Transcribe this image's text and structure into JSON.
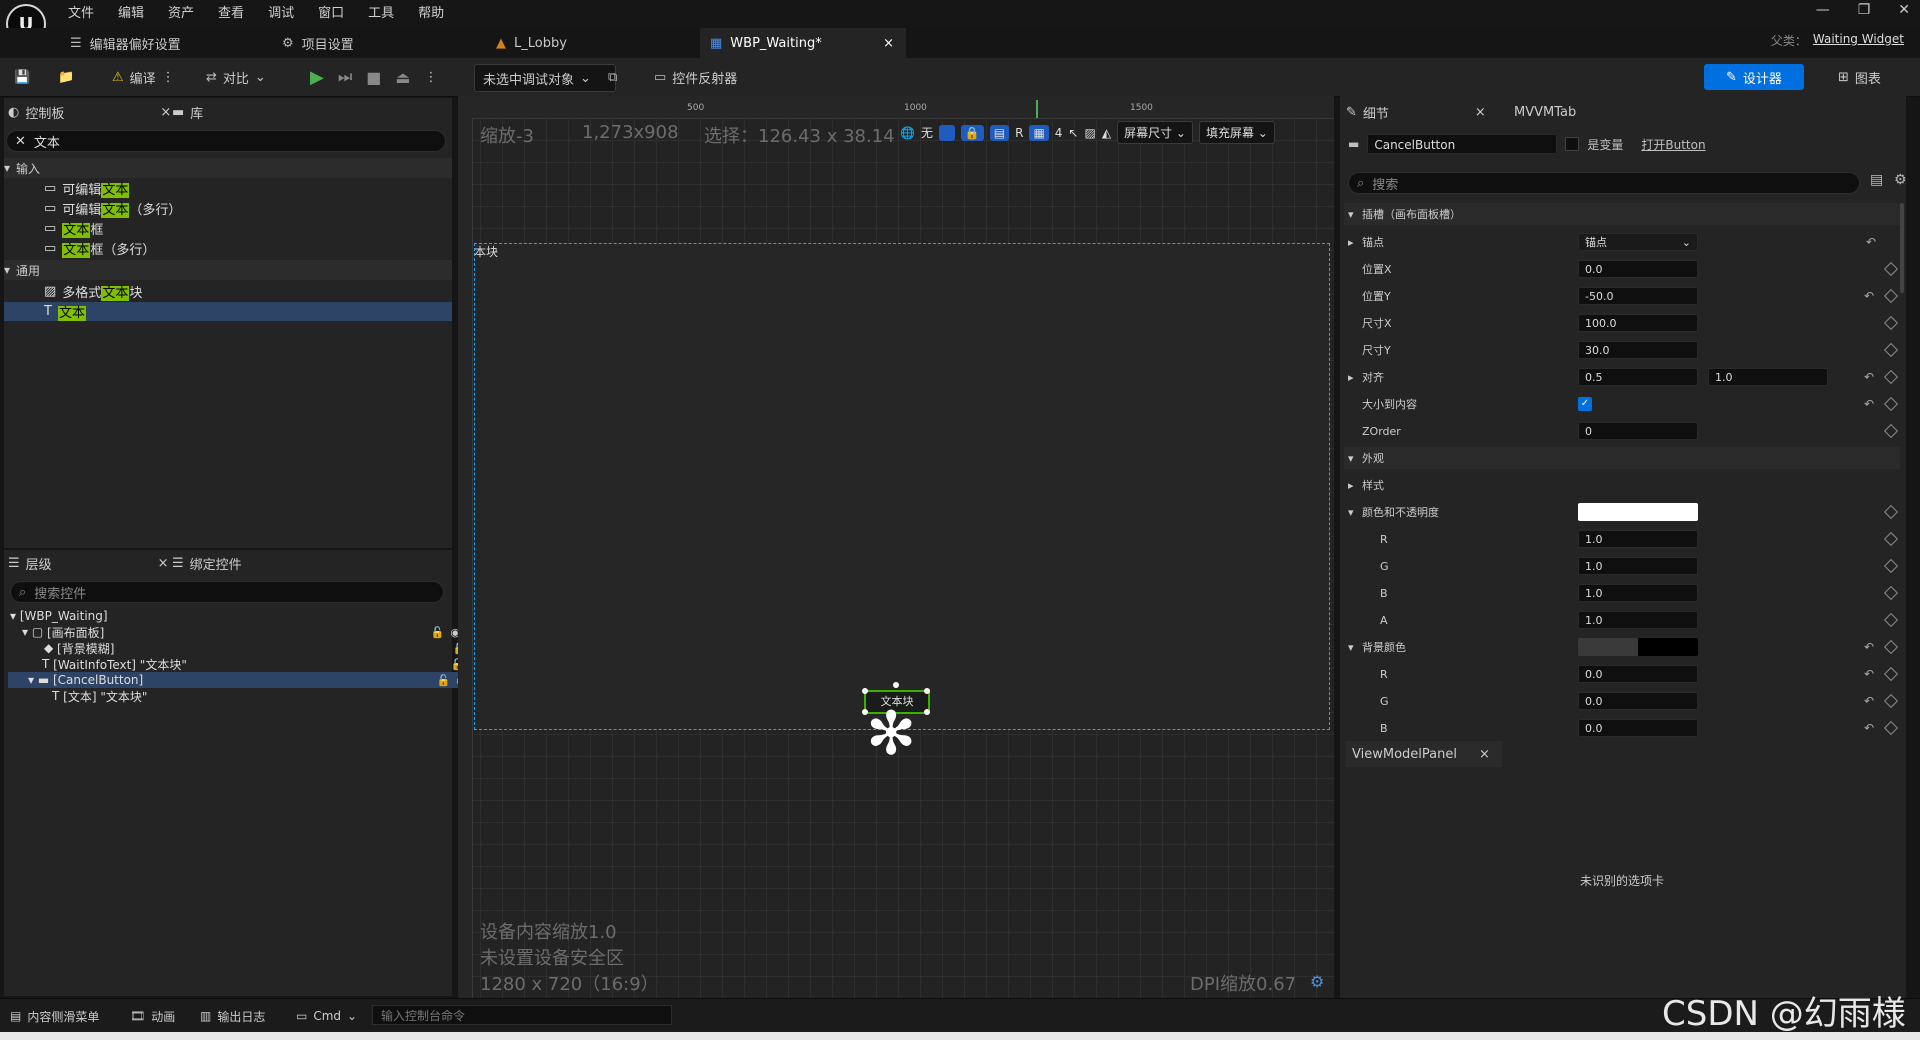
{
  "menu": [
    "文件",
    "编辑",
    "资产",
    "查看",
    "调试",
    "窗口",
    "工具",
    "帮助"
  ],
  "parent_class": {
    "label": "父类：",
    "value": "Waiting Widget"
  },
  "tabs": [
    {
      "label": "编辑器偏好设置"
    },
    {
      "label": "项目设置"
    },
    {
      "label": "L_Lobby"
    },
    {
      "label": "WBP_Waiting*"
    }
  ],
  "toolbar": {
    "compile": "编译",
    "diff": "对比",
    "debug_target": "未选中调试对象",
    "reflector": "控件反射器",
    "designer": "设计器",
    "graph": "图表"
  },
  "palette": {
    "tab_palette": "控制板",
    "tab_library": "库",
    "search_value": "文本",
    "cat_input": "输入",
    "cat_common": "通用",
    "items_input": [
      {
        "pre": "可编辑",
        "hl": "文本",
        "post": ""
      },
      {
        "pre": "可编辑",
        "hl": "文本",
        "post": "（多行）"
      },
      {
        "pre": "",
        "hl": "文本",
        "post": "框"
      },
      {
        "pre": "",
        "hl": "文本",
        "post": "框（多行）"
      }
    ],
    "items_common": [
      {
        "pre": "多格式",
        "hl": "文本",
        "post": "块"
      },
      {
        "pre": "",
        "hl": "文本",
        "post": ""
      }
    ]
  },
  "hierarchy": {
    "tab_hierarchy": "层级",
    "tab_bind": "绑定控件",
    "search_placeholder": "搜索控件",
    "rows": [
      {
        "label": "[WBP_Waiting]"
      },
      {
        "label": "[画布面板]"
      },
      {
        "label": "[背景模糊]"
      },
      {
        "label": "[WaitInfoText] \"文本块\""
      },
      {
        "label": "[CancelButton]"
      },
      {
        "label": "[文本] \"文本块\""
      }
    ]
  },
  "designer": {
    "zoom": "缩放-3",
    "resolution": "1,273x908",
    "selection": "选择：126.43 x 38.14",
    "ruler_marks": [
      "500",
      "1000",
      "1500"
    ],
    "no_label": "无",
    "grid_size": "4",
    "r_label": "R",
    "screen_size": "屏幕尺寸",
    "fill_screen": "填充屏幕",
    "canvas_label": "本块",
    "button_text": "文本块",
    "device_scale": "设备内容缩放1.0",
    "safe_zone": "未设置设备安全区",
    "device_res": "1280 x 720（16:9）",
    "dpi": "DPI缩放0.67"
  },
  "details": {
    "tab_details": "细节",
    "tab_mvvm": "MVVMTab",
    "widget_name": "CancelButton",
    "is_variable": "是变量",
    "open_button": "打开Button",
    "search_placeholder": "搜索",
    "sec_slot": "插槽（画布面板槽）",
    "anchor_label": "锚点",
    "anchor_value": "锚点",
    "pos_x_label": "位置X",
    "pos_x": "0.0",
    "pos_y_label": "位置Y",
    "pos_y": "-50.0",
    "size_x_label": "尺寸X",
    "size_x": "100.0",
    "size_y_label": "尺寸Y",
    "size_y": "30.0",
    "align_label": "对齐",
    "align_x": "0.5",
    "align_y": "1.0",
    "autosize_label": "大小到内容",
    "zorder_label": "ZOrder",
    "zorder": "0",
    "sec_appearance": "外观",
    "style_label": "样式",
    "color_label": "颜色和不透明度",
    "color_r": "1.0",
    "color_g": "1.0",
    "color_b": "1.0",
    "color_a": "1.0",
    "bg_label": "背景颜色",
    "bg_r": "0.0",
    "bg_g": "0.0",
    "bg_b": "0.0",
    "r": "R",
    "g": "G",
    "b": "B",
    "a": "A"
  },
  "viewmodel": {
    "tab": "ViewModelPanel",
    "message": "未识别的选项卡"
  },
  "statusbar": {
    "content_drawer": "内容侧滑菜单",
    "animation": "动画",
    "output_log": "输出日志",
    "cmd": "Cmd",
    "console_placeholder": "输入控制台命令",
    "watermark": "CSDN @幻雨様"
  },
  "colors": {
    "accent": "#0070e0",
    "selection_border": "#1aa8ff",
    "highlight": "#7fbf00"
  }
}
